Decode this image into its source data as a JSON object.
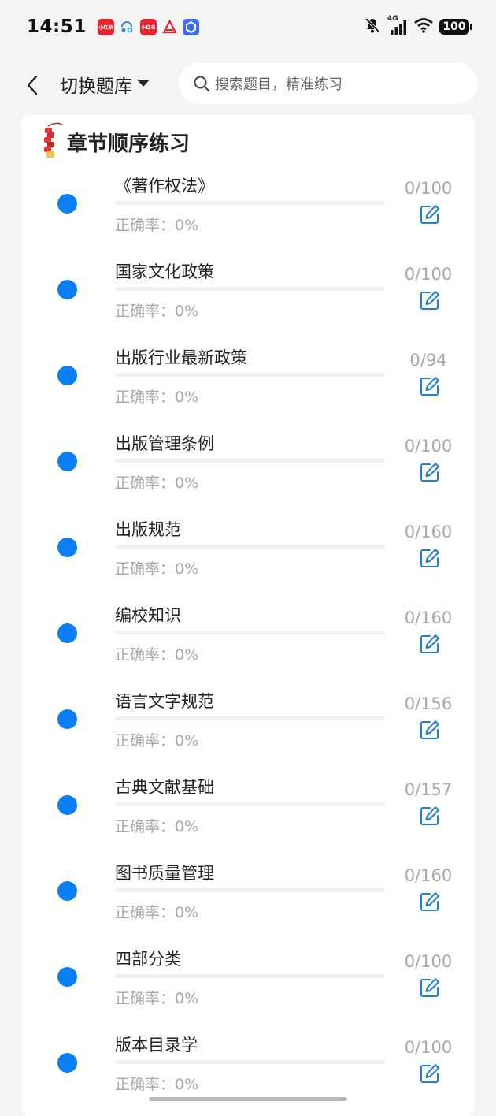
{
  "status_bar": {
    "time": "14:51",
    "app_icons": [
      {
        "name": "xiaohongshu-icon",
        "label": "小红书",
        "color": "#e8232f"
      },
      {
        "name": "assistant-icon",
        "label": "",
        "color": "#2a8cf0"
      },
      {
        "name": "xiaohongshu-icon",
        "label": "小红书",
        "color": "#e8232f"
      },
      {
        "name": "red-app-icon",
        "label": "",
        "color": "#e8232f"
      },
      {
        "name": "blue-app-icon",
        "label": "",
        "color": "#3f6df3"
      }
    ],
    "network": "4G",
    "battery": "100"
  },
  "nav": {
    "switch_label": "切换题库",
    "search_placeholder": "搜索题目，精准练习"
  },
  "section": {
    "title": "章节顺序练习"
  },
  "accent_color": "#0a7ff5",
  "chapters": [
    {
      "title": "《著作权法》",
      "accuracy": "正确率：0%",
      "count": "0/100",
      "progress": 0
    },
    {
      "title": "国家文化政策",
      "accuracy": "正确率：0%",
      "count": "0/100",
      "progress": 0
    },
    {
      "title": "出版行业最新政策",
      "accuracy": "正确率：0%",
      "count": "0/94",
      "progress": 0
    },
    {
      "title": "出版管理条例",
      "accuracy": "正确率：0%",
      "count": "0/100",
      "progress": 0
    },
    {
      "title": "出版规范",
      "accuracy": "正确率：0%",
      "count": "0/160",
      "progress": 0
    },
    {
      "title": "编校知识",
      "accuracy": "正确率：0%",
      "count": "0/160",
      "progress": 0
    },
    {
      "title": "语言文字规范",
      "accuracy": "正确率：0%",
      "count": "0/156",
      "progress": 0
    },
    {
      "title": "古典文献基础",
      "accuracy": "正确率：0%",
      "count": "0/157",
      "progress": 0
    },
    {
      "title": "图书质量管理",
      "accuracy": "正确率：0%",
      "count": "0/160",
      "progress": 0
    },
    {
      "title": "四部分类",
      "accuracy": "正确率：0%",
      "count": "0/100",
      "progress": 0
    },
    {
      "title": "版本目录学",
      "accuracy": "正确率：0%",
      "count": "0/100",
      "progress": 0
    }
  ]
}
